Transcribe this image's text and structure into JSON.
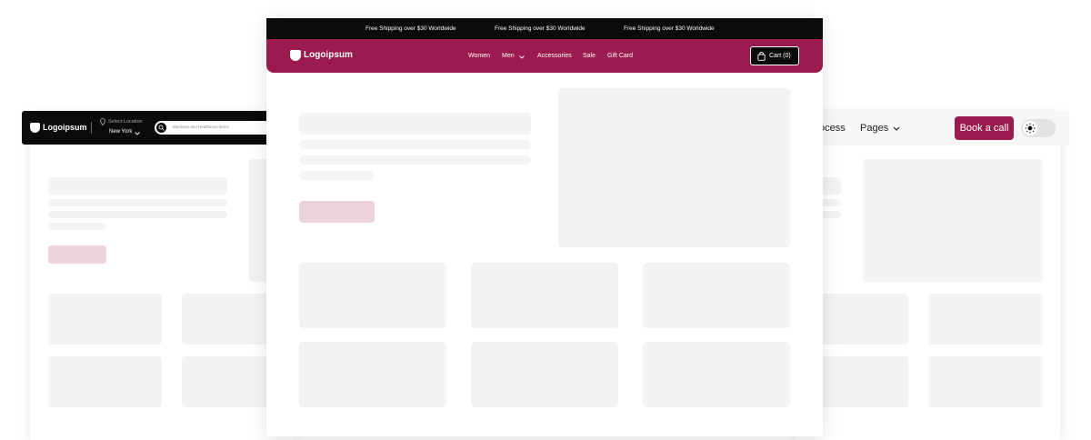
{
  "colors": {
    "brand": "#9b1b4e",
    "dark": "#0b0b0b",
    "skeleton": "#f3f3f3",
    "skeleton_accent": "#ecd2db"
  },
  "left_window": {
    "logo_text": "Logoipsum",
    "location_label": "Select Location",
    "location_value": "New York",
    "search_placeholder": "Medicine and Healthcare items"
  },
  "center_window": {
    "announcements": [
      "Free Shipping over $30 Worldwide",
      "Free Shipping over $30 Worldwide",
      "Free Shipping over $30 Worldwide"
    ],
    "logo_text": "Logoipsum",
    "nav": [
      "Women",
      "Men",
      "Accessories",
      "Sale",
      "Gift Card"
    ],
    "cart_label": "Cart (0)"
  },
  "right_window": {
    "nav": [
      "Process",
      "Pages"
    ],
    "cta_label": "Book a call",
    "theme_icon": "sun-icon"
  }
}
